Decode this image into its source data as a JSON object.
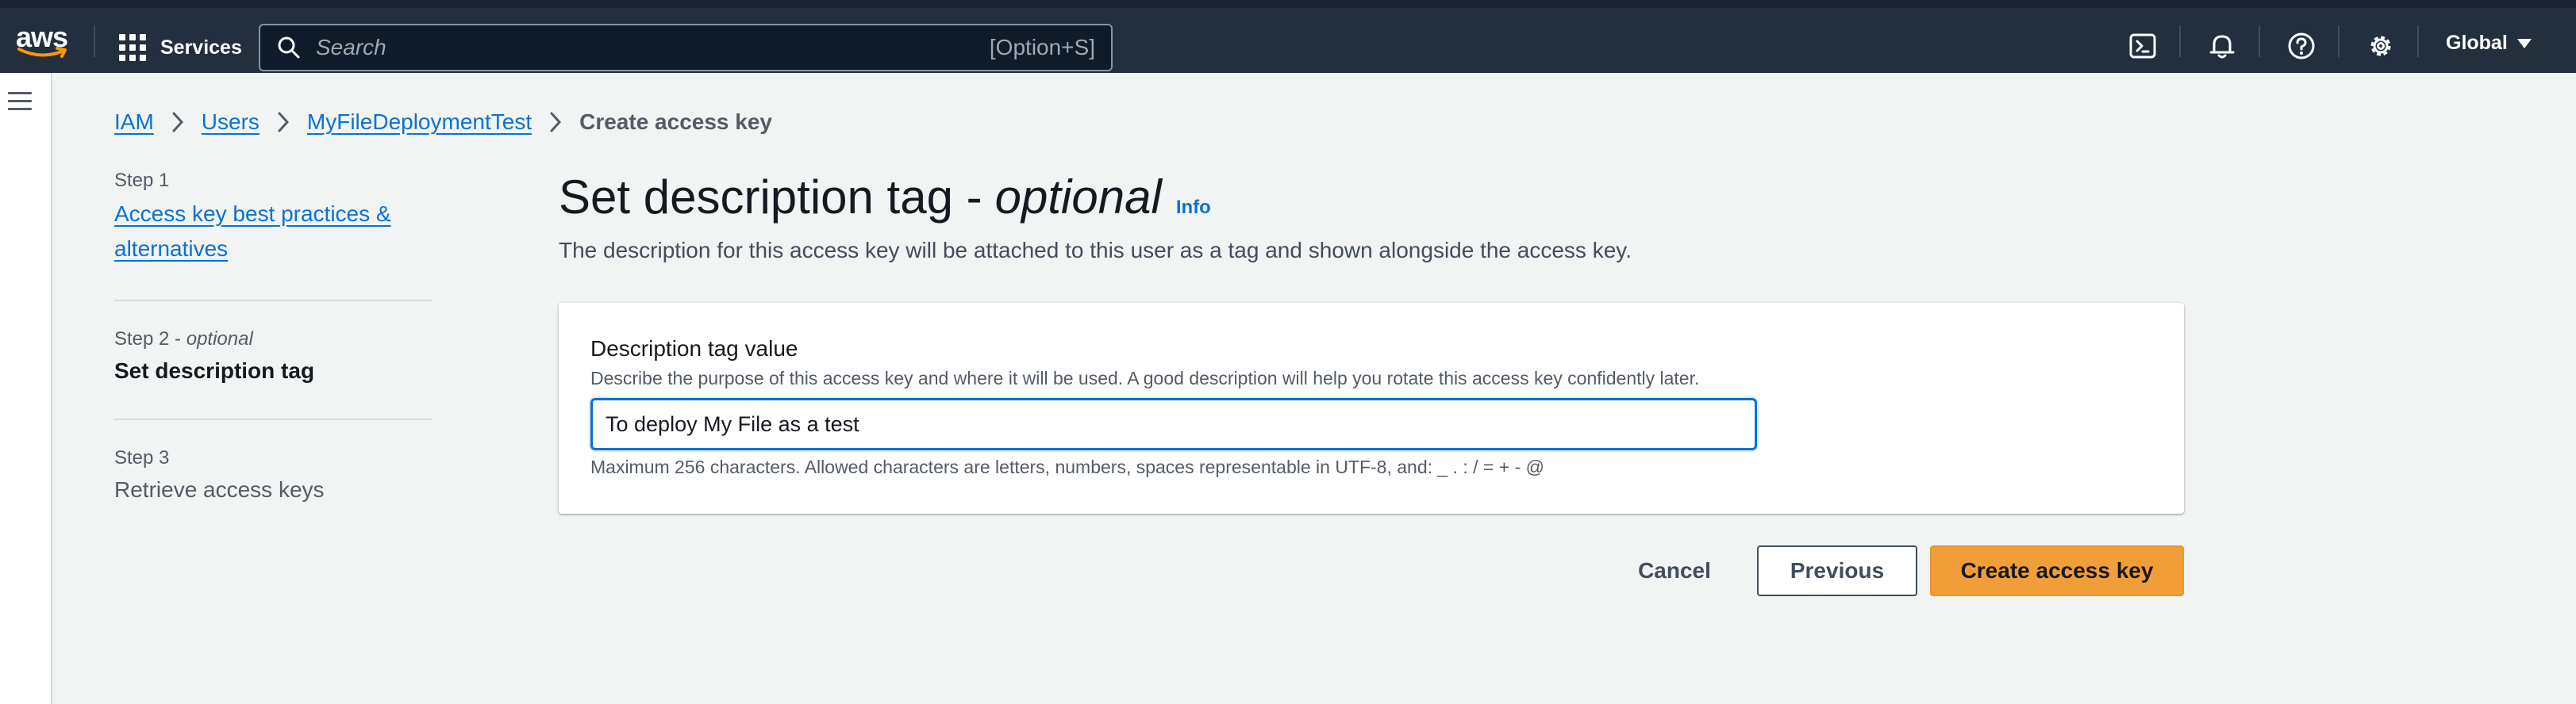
{
  "nav": {
    "logo_text": "aws",
    "services_label": "Services",
    "search_placeholder": "Search",
    "search_shortcut": "[Option+S]",
    "region_label": "Global",
    "icons": [
      "cloudshell-icon",
      "bell-icon",
      "help-icon",
      "settings-icon"
    ]
  },
  "breadcrumb": {
    "items": [
      "IAM",
      "Users",
      "MyFileDeploymentTest"
    ],
    "current": "Create access key"
  },
  "steps": [
    {
      "label": "Step 1",
      "title": "Access key best practices & alternatives"
    },
    {
      "label": "Step 2",
      "optional": "optional",
      "title": "Set description tag"
    },
    {
      "label": "Step 3",
      "title": "Retrieve access keys"
    }
  ],
  "main": {
    "title": "Set description tag -",
    "title_optional": "optional",
    "info_link": "Info",
    "description": "The description for this access key will be attached to this user as a tag and shown alongside the access key."
  },
  "form": {
    "label": "Description tag value",
    "description": "Describe the purpose of this access key and where it will be used. A good description will help you rotate this access key confidently later.",
    "value": "To deploy My File as a test",
    "hint": "Maximum 256 characters. Allowed characters are letters, numbers, spaces representable in UTF-8, and: _ . : / = + - @"
  },
  "actions": {
    "cancel": "Cancel",
    "previous": "Previous",
    "create": "Create access key"
  },
  "colors": {
    "nav_bg": "#232f3e",
    "link": "#0972d3",
    "primary": "#f29e38",
    "page_bg": "#f2f3f3"
  }
}
